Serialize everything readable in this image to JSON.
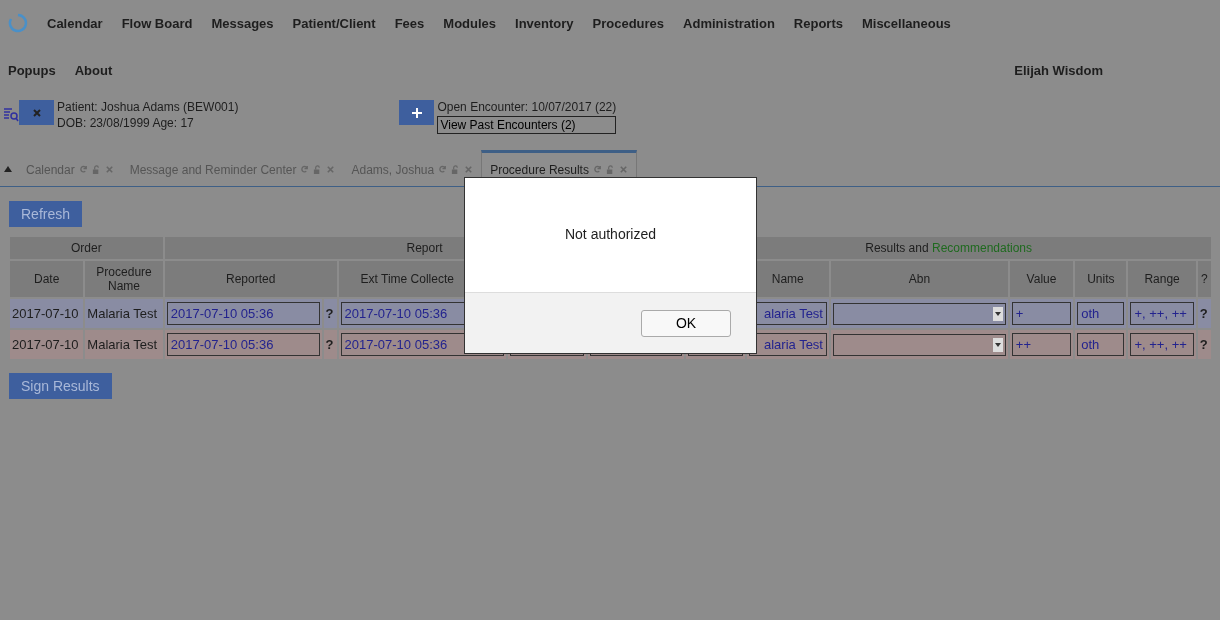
{
  "menu": [
    "Calendar",
    "Flow Board",
    "Messages",
    "Patient/Client",
    "Fees",
    "Modules",
    "Inventory",
    "Procedures",
    "Administration",
    "Reports",
    "Miscellaneous"
  ],
  "submenu": [
    "Popups",
    "About"
  ],
  "user": "Elijah Wisdom",
  "patient": {
    "line1": "Patient: Joshua Adams (BEW001)",
    "line2": "DOB: 23/08/1999 Age: 17"
  },
  "encounter": {
    "open": "Open Encounter: 10/07/2017 (22)",
    "past": "View Past Encounters (2)"
  },
  "tabs": [
    {
      "label": "Calendar",
      "selected": false
    },
    {
      "label": "Message and Reminder Center",
      "selected": false
    },
    {
      "label": "Adams, Joshua",
      "selected": false
    },
    {
      "label": "Procedure Results",
      "selected": true
    }
  ],
  "refresh": "Refresh",
  "groups": {
    "order": "Order",
    "report": "Report",
    "results": "Results and",
    "recommendations": "Recommendations"
  },
  "columns": {
    "date": "Date",
    "procedure": "Procedure Name",
    "reported": "Reported",
    "ext_time": "Ext Time Collecte",
    "name": "Name",
    "abn": "Abn",
    "value": "Value",
    "units": "Units",
    "range": "Range",
    "help": "?"
  },
  "rows": [
    {
      "color": "#898ca3",
      "date": "2017-07-10",
      "procedure": "Malaria Test",
      "reported": "2017-07-10 05:36",
      "help1": "?",
      "ext_time": "2017-07-10 05:36",
      "name": "alaria Test",
      "value": "+",
      "units": "oth",
      "range": "+, ++, ++",
      "help2": "?"
    },
    {
      "color": "#9e8b8b",
      "date": "2017-07-10",
      "procedure": "Malaria Test",
      "reported": "2017-07-10 05:36",
      "help1": "?",
      "ext_time": "2017-07-10 05:36",
      "name": "alaria Test",
      "value": "++",
      "units": "oth",
      "range": "+, ++, ++",
      "help2": "?"
    }
  ],
  "sign": "Sign Results",
  "dialog": {
    "message": "Not authorized",
    "button": "OK"
  }
}
